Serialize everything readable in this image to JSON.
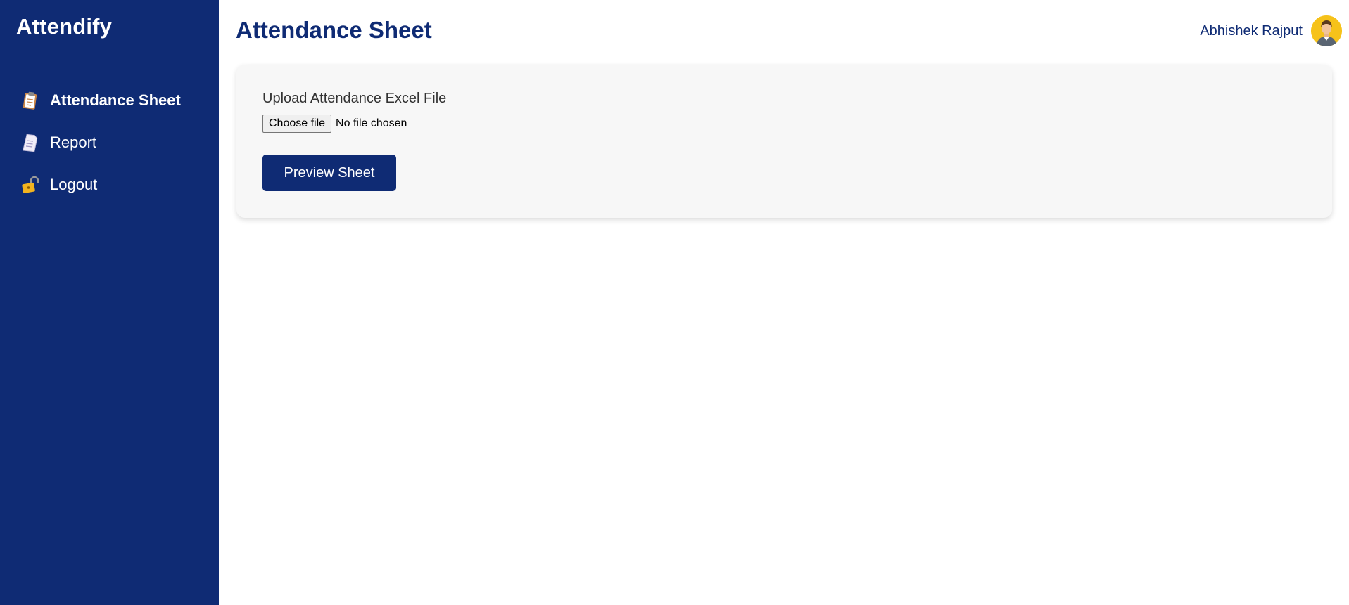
{
  "app": {
    "brand": "Attendify"
  },
  "sidebar": {
    "items": [
      {
        "label": "Attendance Sheet",
        "icon": "clipboard-icon",
        "active": true
      },
      {
        "label": "Report",
        "icon": "document-icon",
        "active": false
      },
      {
        "label": "Logout",
        "icon": "unlocked-padlock-icon",
        "active": false
      }
    ]
  },
  "header": {
    "title": "Attendance Sheet",
    "user_name": "Abhishek Rajput",
    "avatar_icon": "user-avatar-icon"
  },
  "upload": {
    "label": "Upload Attendance Excel File",
    "choose_label": "Choose file",
    "status": "No file chosen",
    "button_label": "Preview Sheet"
  },
  "colors": {
    "primary": "#0f2b74",
    "card_bg": "#f7f7f7",
    "avatar_bg": "#f6c21a",
    "text": "#333333"
  }
}
